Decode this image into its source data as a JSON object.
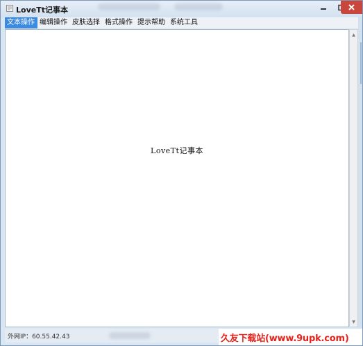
{
  "window": {
    "title": "LoveTt记事本"
  },
  "menu": {
    "items": [
      {
        "label": "文本操作",
        "active": true
      },
      {
        "label": "编辑操作",
        "active": false
      },
      {
        "label": "皮肤选择",
        "active": false
      },
      {
        "label": "格式操作",
        "active": false
      },
      {
        "label": "提示帮助",
        "active": false
      },
      {
        "label": "系统工具",
        "active": false
      }
    ]
  },
  "editor": {
    "content": "LoveTt记事本"
  },
  "status": {
    "text": "外网IP：60.55.42.43"
  },
  "watermark": {
    "text": "久友下载站(www.9upk.com)"
  },
  "colors": {
    "accent": "#3c8be0",
    "close_button": "#c9463d",
    "watermark": "#e5221b"
  }
}
